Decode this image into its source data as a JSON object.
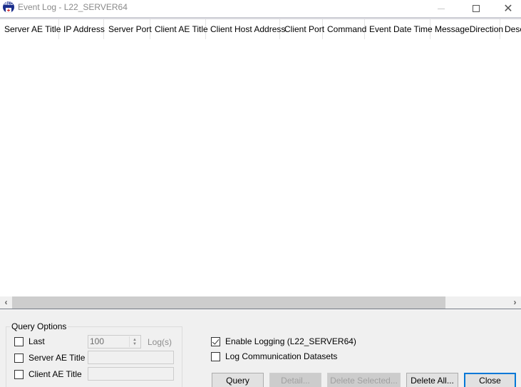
{
  "window": {
    "title": "Event Log - L22_SERVER64",
    "icon": "med-app-icon",
    "controls": [
      "minimize",
      "maximize",
      "close"
    ]
  },
  "listview": {
    "columns": [
      "Server AE Title",
      "IP Address",
      "Server Port",
      "Client AE Title",
      "Client Host Address",
      "Client Port",
      "Command",
      "Event Date Time",
      "MessageDirection",
      "Desc"
    ],
    "rows": []
  },
  "query_options": {
    "title": "Query Options",
    "last": {
      "label": "Last",
      "checked": false,
      "value": "100",
      "unit": "Log(s)"
    },
    "server_ae_title": {
      "label": "Server AE Title",
      "checked": false,
      "value": ""
    },
    "client_ae_title": {
      "label": "Client AE Title",
      "checked": false,
      "value": ""
    }
  },
  "settings": {
    "enable_logging": {
      "label": "Enable Logging (L22_SERVER64)",
      "checked": true
    },
    "log_datasets": {
      "label": "Log Communication Datasets",
      "checked": false
    }
  },
  "buttons": {
    "query": "Query",
    "detail": "Detail...",
    "delete_selected": "Delete Selected...",
    "delete_all": "Delete All...",
    "close": "Close"
  }
}
